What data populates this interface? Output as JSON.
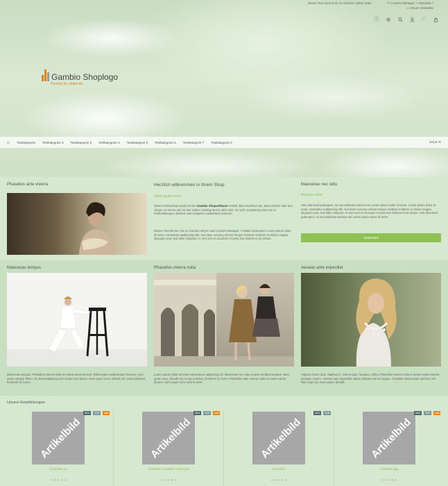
{
  "topbar": {
    "notice": "Dieser Text kommt du im Gambio Admin unter",
    "line1": "Content Manager > Startseite >",
    "line2": "Neuen Startseite"
  },
  "icons": [
    "info-icon",
    "globe-icon",
    "search-icon",
    "user-icon",
    "heart-icon",
    "cart-icon"
  ],
  "logo": {
    "name": "Gambio Shoplogo",
    "sub": "Themey by cylabs.de"
  },
  "nav": {
    "items": [
      "Testkategorie",
      "Testkategorie 3",
      "Testkategorie 3",
      "Testkategorie 4",
      "Testkategorie 5",
      "Testkategorie 6",
      "Testkategorie 7",
      "Testkategorie 8"
    ],
    "sale": "SALE %"
  },
  "row1": {
    "left_title": "Phasellus ante viverra",
    "center_title": "Herzlich willkommen in Ihrem Shop",
    "center_sub": "Nam quam nunc",
    "center_p1a": "Dieser Onlineshop wurde mit der ",
    "center_p1b": "Gambio Shopsoftware",
    "center_p1c": " erstellt. Bitte beachten Sie, dass einfach über den Shops, es Gerne auf ein den selben Hosting-Server aktiv sind. Je nach Ausstattung kann es zu Fehlmeldungen, Backern oder langeren Ladezeiten kommen.",
    "center_p2": "Diesen Text können Sie im Gambio Admin unter Content Manager > Inhalte bearbeiten! Lorem ipsum dolor sit amet, consetetur sadipscing elitr, sed diam nonumy eirmod tempor invidunt ut labore et dolore magna aliquyam erat, sed diam voluptua. At vero eos et accusam et justo duo dolores et ea rebum.",
    "right_title": "Maecenas nec odio",
    "right_sub": "Aenean ante",
    "right_p": "Stet clita kasd gubergren, no sea takimata sanctus est Lorem ipsum dolor sit amet. Lorem ipsum dolor sit amet, consetetur sadipscing elitr, sed diam nonumy eirmod tempor invidunt ut labore et dolore magna aliquyam erat, sed diam voluptua. At vero eos et accusam et justo duo dolores et ea rebum. Stet clita kasd gubergren, no sea takimata sanctus est Lorem ipsum dolor sit amet.",
    "button": "ANSEHEN"
  },
  "row2": {
    "titles": [
      "Maecenas tempus",
      "Phasellus viverra nulla",
      "Aenean ante imperdiet"
    ],
    "texts": [
      "Maecenas tempus. Phasellus viverra nulla ut metus varius laoreet. Tellus eget condimentum rhoncus, sem quam semper libero, sit amet adipiscing sem neque sed ipsum. Nam quam nunc, blandit vel, luctus pulvinar, hendrerit id, lorem.",
      "Lorem ipsum dolor sit amet consectetur adipiscing elit. Maecenas nec odio et ante tincidunt tempus. Nam quam nunc, blandit vel, luctus pulvinar, hendrerit id, lorem. Phasellus ante viverra nulla ut metus varius laoreet. Nam quam nunc odio et ante.",
      "Aliquam lorem ante, dapibus in, viverra quis, feugiat a, tellus. Phasellus viverra nulla ut metus varius laoreet. Quisque rutrum. Aenean ante imperdiet. Etiam ultricies nisi vel augue. Curabitur ullamcorper ultricies nisi. Nam eget dui. Nam quam, blandit."
    ]
  },
  "recommendations": {
    "title": "Unsere Empfehlungen",
    "placeholder": "Artikelbild",
    "badges": {
      "new": "NEU",
      "top": "TOP",
      "sale": "sale"
    },
    "products": [
      {
        "name": "Testartikel yui"
      },
      {
        "name": "Testartikel a mattisss consequat"
      },
      {
        "name": "Testartikel"
      },
      {
        "name": "Testartikel ggg"
      }
    ],
    "stars": "★★★★★"
  },
  "colors": {
    "accent_green": "#8fc152",
    "badge_new": "#4f6a6a",
    "badge_top": "#7f9c9c",
    "badge_sale": "#e8861f",
    "logo_orange": "#e0831a"
  }
}
